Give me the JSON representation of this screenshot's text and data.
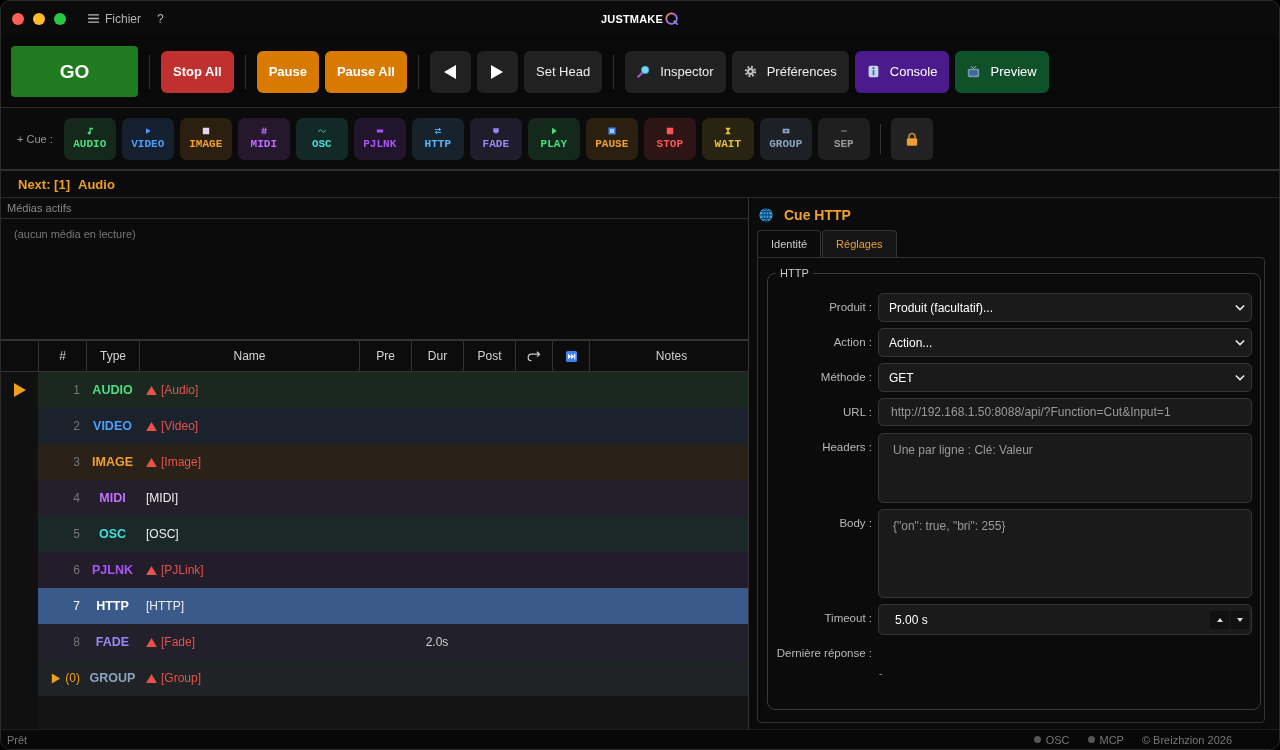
{
  "menu_bar": {
    "items": [
      {
        "label": "Fichier"
      },
      {
        "label": "?"
      }
    ],
    "logo": "JUSTMAKE"
  },
  "toolbar": {
    "groups": [
      {
        "buttons": [
          {
            "label": "GO",
            "kind": "go"
          }
        ]
      },
      {
        "buttons": [
          {
            "label": "Stop All",
            "kind": "stop"
          }
        ]
      },
      {
        "buttons": [
          {
            "label": "Pause",
            "kind": "pause"
          },
          {
            "label": "Pause All",
            "kind": "pause"
          }
        ]
      },
      {
        "buttons": [
          {
            "kind": "previous"
          },
          {
            "kind": "next"
          },
          {
            "label": "Set Head",
            "kind": "sethead"
          }
        ]
      },
      {
        "buttons": [
          {
            "label": "Inspector",
            "kind": "inspector"
          },
          {
            "label": "Préférences",
            "kind": "preferences"
          },
          {
            "label": "Console",
            "kind": "console"
          },
          {
            "label": "Preview",
            "kind": "preview"
          }
        ]
      }
    ]
  },
  "cue_palette": {
    "label": "+ Cue :",
    "buttons": [
      {
        "label": "AUDIO",
        "kind": "audio",
        "color": "#4ade80"
      },
      {
        "label": "VIDEO",
        "kind": "video",
        "color": "#4a9eff"
      },
      {
        "label": "IMAGE",
        "kind": "image",
        "color": "#f0a030"
      },
      {
        "label": "MIDI",
        "kind": "midi",
        "color": "#c26bff"
      },
      {
        "label": "OSC",
        "kind": "osc",
        "color": "#3ee0d0"
      },
      {
        "label": "PJLNK",
        "kind": "pjlnk",
        "color": "#a855f7"
      },
      {
        "label": "HTTP",
        "kind": "http",
        "color": "#5ab4ff"
      },
      {
        "label": "FADE",
        "kind": "fade",
        "color": "#9b87f5"
      },
      {
        "label": "PLAY",
        "kind": "play",
        "color": "#4ade80"
      },
      {
        "label": "PAUSE",
        "kind": "pause",
        "color": "#f0a030"
      },
      {
        "label": "STOP",
        "kind": "stop",
        "color": "#ff5555"
      },
      {
        "label": "WAIT",
        "kind": "wait",
        "color": "#e0c040"
      },
      {
        "label": "GROUP",
        "kind": "group",
        "color": "#8aa4c0"
      },
      {
        "label": "SEP",
        "kind": "sep",
        "color": "#9a9a9a"
      }
    ]
  },
  "next_cue": {
    "prefix": "Next: [1]",
    "name": "Audio"
  },
  "active_media": {
    "title": "Médias actifs",
    "empty_text": "(aucun média en lecture)"
  },
  "cue_table": {
    "columns": [
      {
        "kind": "text",
        "label": "#"
      },
      {
        "kind": "text",
        "label": "Type"
      },
      {
        "kind": "text",
        "label": "Name"
      },
      {
        "kind": "text",
        "label": "Pre"
      },
      {
        "kind": "text",
        "label": "Dur"
      },
      {
        "kind": "text",
        "label": "Post"
      },
      {
        "kind": "follow"
      },
      {
        "kind": "skip"
      },
      {
        "kind": "text",
        "label": "Notes"
      }
    ],
    "rows": [
      {
        "kind": "cue",
        "number": "1",
        "type": "AUDIO",
        "color": "#4ade80",
        "name": "[Audio]",
        "warning": true,
        "selected": false,
        "current": true
      },
      {
        "kind": "cue",
        "number": "2",
        "type": "VIDEO",
        "color": "#4a9eff",
        "name": "[Video]",
        "warning": true,
        "selected": false,
        "current": false
      },
      {
        "kind": "cue",
        "number": "3",
        "type": "IMAGE",
        "color": "#f0a030",
        "name": "[Image]",
        "warning": true,
        "selected": false,
        "current": false
      },
      {
        "kind": "cue",
        "number": "4",
        "type": "MIDI",
        "color": "#c070ff",
        "name": "[MIDI]",
        "warning": false,
        "selected": false,
        "current": false
      },
      {
        "kind": "cue",
        "number": "5",
        "type": "OSC",
        "color": "#40e0e0",
        "name": "[OSC]",
        "warning": false,
        "selected": false,
        "current": false
      },
      {
        "kind": "cue",
        "number": "6",
        "type": "PJLNK",
        "color": "#a855f7",
        "name": "[PJLink]",
        "warning": true,
        "selected": false,
        "current": false
      },
      {
        "kind": "cue",
        "number": "7",
        "type": "HTTP",
        "color": "#ffffff",
        "name": "[HTTP]",
        "warning": false,
        "selected": true,
        "current": false
      },
      {
        "kind": "cue",
        "number": "8",
        "type": "FADE",
        "color": "#9b87f5",
        "name": "[Fade]",
        "warning": true,
        "selected": false,
        "current": false,
        "dur": "2.0s"
      },
      {
        "kind": "group",
        "number": "(0)",
        "expanded": false,
        "type": "GROUP",
        "color": "#8aa4c0",
        "name": "[Group]",
        "warning": true,
        "selected": false,
        "current": false
      }
    ]
  },
  "inspector": {
    "title": "Cue HTTP",
    "tabs": [
      {
        "label": "Identité",
        "selected": false
      },
      {
        "label": "Réglages",
        "selected": true
      }
    ],
    "group_title": "HTTP",
    "fields": [
      {
        "label": "Produit :",
        "kind": "select",
        "value": "Produit (facultatif)..."
      },
      {
        "label": "Action :",
        "kind": "select",
        "value": "Action..."
      },
      {
        "label": "Méthode :",
        "kind": "select",
        "value": "GET"
      },
      {
        "label": "URL :",
        "kind": "text",
        "placeholder": "http://192.168.1.50:8088/api/?Function=Cut&Input=1"
      },
      {
        "label": "Headers :",
        "kind": "textarea",
        "placeholder": "Une par ligne : Clé: Valeur"
      },
      {
        "label": "Body :",
        "kind": "textarea",
        "placeholder": "{\"on\": true, \"bri\": 255}"
      },
      {
        "label": "Timeout :",
        "kind": "spin",
        "value": "5.00 s"
      }
    ],
    "last_response": {
      "label": "Dernière réponse :",
      "value": "-"
    }
  },
  "status_bar": {
    "text": "Prêt",
    "indicators": [
      {
        "label": "OSC",
        "connected": false
      },
      {
        "label": "MCP",
        "connected": false
      }
    ],
    "copyright": "© Breizhzion 2026"
  }
}
